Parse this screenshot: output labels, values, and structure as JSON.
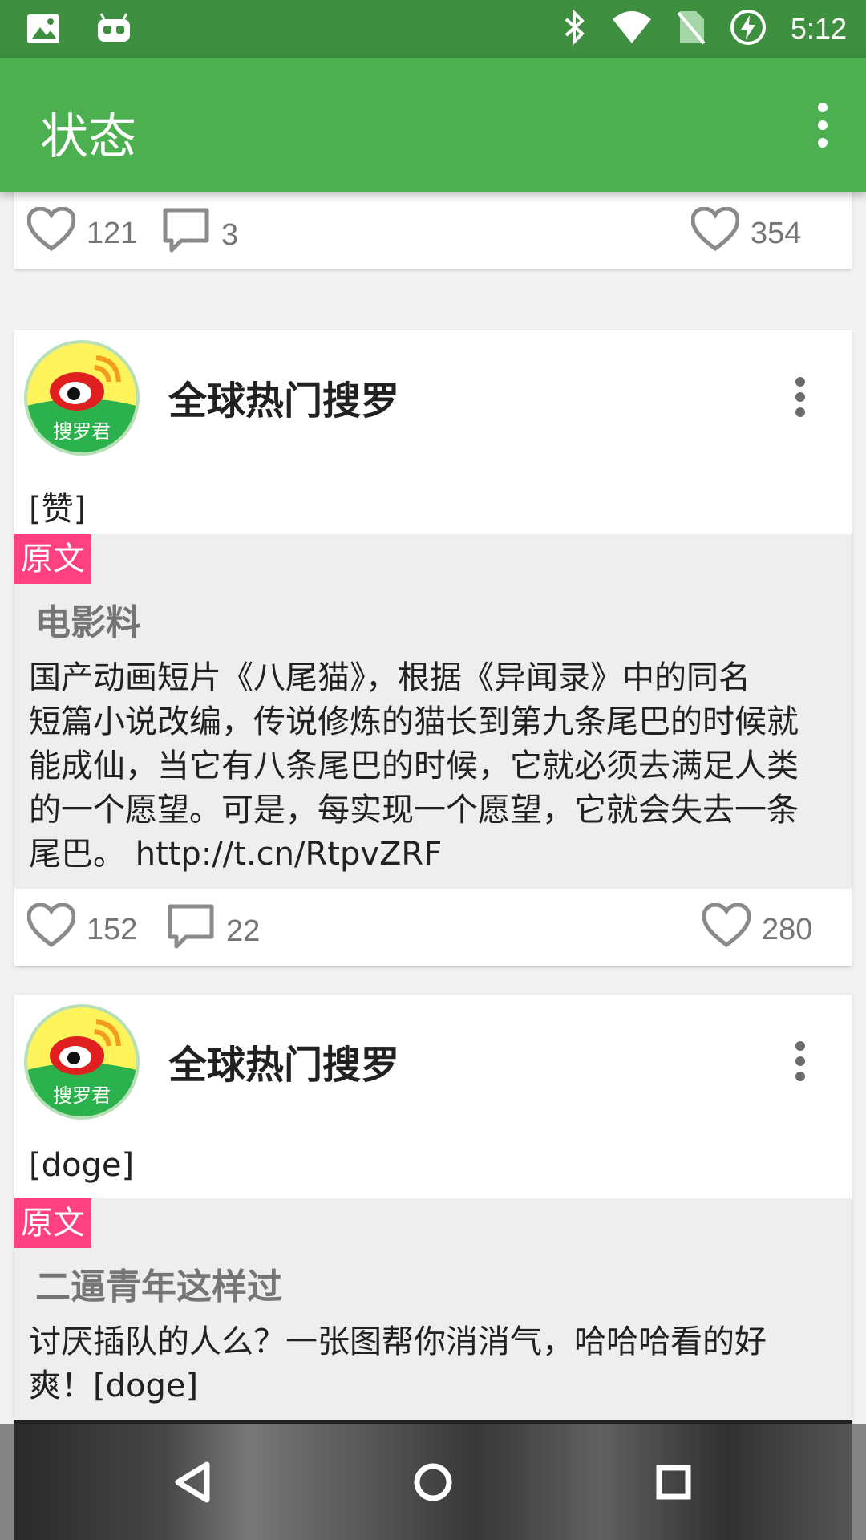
{
  "status_bar": {
    "time": "5:12",
    "icons": [
      "image-icon",
      "android-icon",
      "bluetooth-icon",
      "wifi-icon",
      "no-sim-icon",
      "battery-charging-icon"
    ]
  },
  "app_bar": {
    "title": "状态",
    "more_icon": "more-vert-icon"
  },
  "prev_card": {
    "likes": "121",
    "comments": "3",
    "quote_likes": "354"
  },
  "posts": [
    {
      "author": "全球热门搜罗",
      "avatar_text": "搜罗君",
      "text": "[赞]",
      "quote_badge": "原文",
      "quote_author": "电影料",
      "quote_lines": [
        "国产动画短片《八尾猫》，根据《异闻录》中的同名",
        "短篇小说改编，传说修炼的猫长到第九条尾巴的时候就",
        "能成仙，当它有八条尾巴的时候，它就必须去满足人类",
        "的一个愿望。可是，每实现一个愿望，它就会失去一条",
        "尾巴。 http://t.cn/RtpvZRF"
      ],
      "likes": "152",
      "comments": "22",
      "quote_likes": "280"
    },
    {
      "author": "全球热门搜罗",
      "avatar_text": "搜罗君",
      "text": "[doge]",
      "quote_badge": "原文",
      "quote_author": "二逼青年这样过",
      "quote_lines": [
        "讨厌插队的人么？一张图帮你消消气，哈哈哈看的好",
        "爽！[doge]"
      ]
    }
  ],
  "nav_bar": {
    "buttons": [
      "back-icon",
      "home-icon",
      "recents-icon"
    ]
  }
}
